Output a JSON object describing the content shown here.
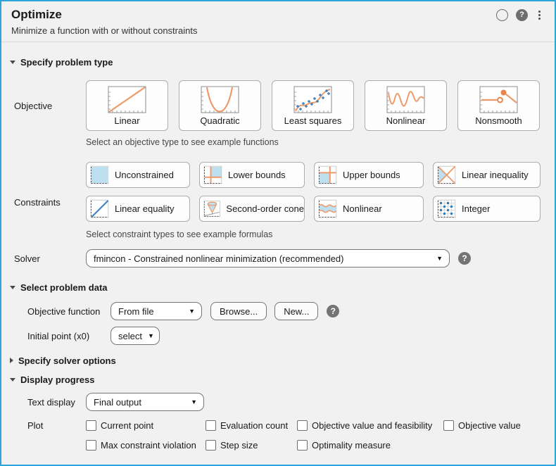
{
  "header": {
    "title": "Optimize",
    "subtitle": "Minimize a function with or without constraints"
  },
  "icons": {
    "help_glyph": "?",
    "dropdown_arrow": "▼"
  },
  "problem_type": {
    "heading": "Specify problem type",
    "objective_label": "Objective",
    "objective_options": [
      "Linear",
      "Quadratic",
      "Least squares",
      "Nonlinear",
      "Nonsmooth"
    ],
    "objective_hint": "Select an objective type to see example functions",
    "constraints_label": "Constraints",
    "constraint_rows": [
      [
        "Unconstrained",
        "Lower bounds",
        "Upper bounds",
        "Linear inequality"
      ],
      [
        "Linear equality",
        "Second-order cone",
        "Nonlinear",
        "Integer"
      ]
    ],
    "constraints_hint": "Select constraint types to see example formulas",
    "solver_label": "Solver",
    "solver_value": "fmincon - Constrained nonlinear minimization (recommended)"
  },
  "problem_data": {
    "heading": "Select problem data",
    "objective_function_label": "Objective function",
    "objective_function_value": "From file",
    "browse_label": "Browse...",
    "new_label": "New...",
    "initial_point_label": "Initial point (x0)",
    "initial_point_value": "select"
  },
  "solver_options": {
    "heading": "Specify solver options"
  },
  "display_progress": {
    "heading": "Display progress",
    "text_display_label": "Text display",
    "text_display_value": "Final output",
    "plot_label": "Plot",
    "plot_rows": [
      [
        "Current point",
        "Evaluation count",
        "Objective value and feasibility",
        "Objective value"
      ],
      [
        "Max constraint violation",
        "Step size",
        "Optimality measure"
      ]
    ]
  },
  "colors": {
    "window_border": "#2da4dc",
    "accent_orange": "#ed9b6c",
    "accent_blue": "#3c7fbe",
    "light_blue_fill": "#beddf0",
    "background": "#f1f1f1"
  }
}
